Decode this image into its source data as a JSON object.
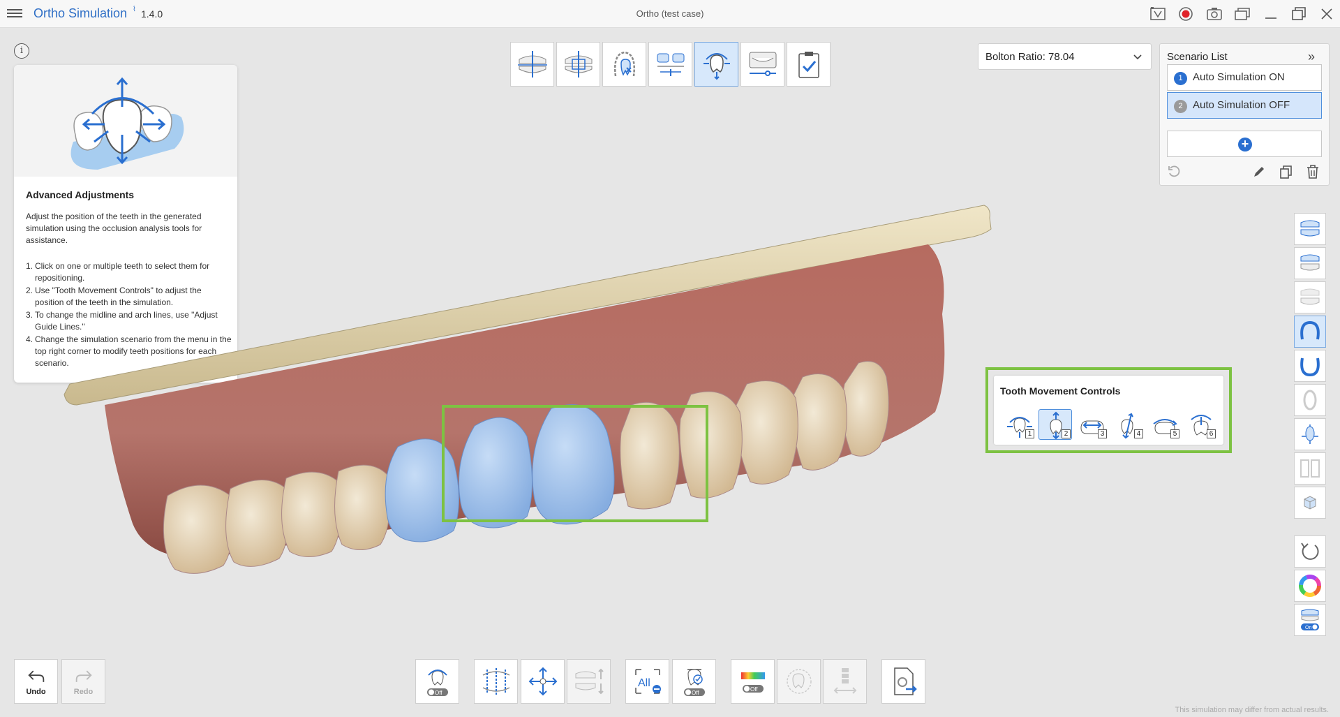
{
  "app": {
    "name": "Ortho Simulation",
    "version": "1.4.0",
    "document_title": "Ortho (test case)"
  },
  "titlebar_icons": [
    "guide-icon",
    "record-icon",
    "camera-icon",
    "screenshot-gallery-icon",
    "minimize-icon",
    "restore-icon",
    "close-icon"
  ],
  "help": {
    "info_glyph": "i",
    "title": "Advanced Adjustments",
    "description": "Adjust the position of the teeth in the generated simulation using the occlusion analysis tools for assistance.",
    "steps": [
      {
        "num": "1.",
        "text": "Click on one or multiple teeth to select them for repositioning."
      },
      {
        "num": "2.",
        "text": "Use \"Tooth Movement Controls\" to adjust the position of the teeth in the simulation."
      },
      {
        "num": "3.",
        "text": "To change the midline and arch lines, use \"Adjust Guide Lines.\""
      },
      {
        "num": "4.",
        "text": "Change the simulation scenario from the menu in the top right corner to modify teeth positions for each scenario."
      }
    ]
  },
  "top_toolbar": {
    "active_index": 4,
    "tools": [
      "midline-tool-icon",
      "arch-line-tool-icon",
      "tooth-exclude-icon",
      "segmentation-icon",
      "advanced-adjustment-icon",
      "smile-preview-icon",
      "complete-icon"
    ]
  },
  "bolton": {
    "label": "Bolton Ratio: 78.04"
  },
  "scenario_list": {
    "title": "Scenario List",
    "items": [
      {
        "num": "1",
        "label": "Auto Simulation ON",
        "color": "#2a6fd0",
        "selected": false
      },
      {
        "num": "2",
        "label": "Auto Simulation OFF",
        "color": "#9a9a9a",
        "selected": true
      }
    ]
  },
  "tooth_movement": {
    "title": "Tooth Movement Controls",
    "active_index": 1,
    "buttons": [
      "1",
      "2",
      "3",
      "4",
      "5",
      "6"
    ]
  },
  "bottom_toolbar": {
    "undo_label": "Undo",
    "redo_label": "Redo",
    "off_badge": "Off",
    "all_label": "All"
  },
  "right_toolbar": {
    "on_badge": "On"
  },
  "footer": {
    "note": "This simulation may differ from actual results."
  },
  "colors": {
    "accent": "#2f6fc6",
    "highlight_frame": "#7dc242",
    "selected_teeth": "#a7c8ef"
  }
}
